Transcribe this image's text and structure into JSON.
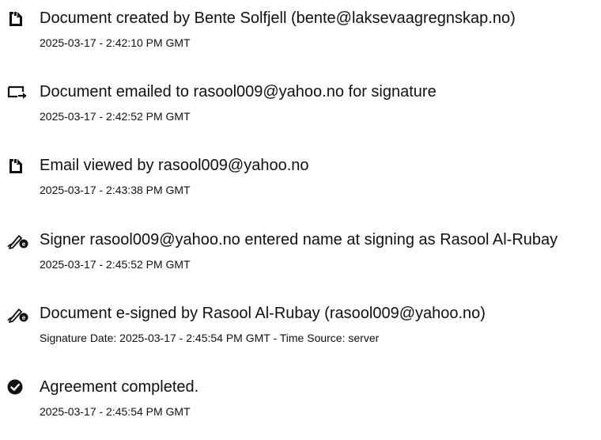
{
  "events": [
    {
      "icon": "document-icon",
      "title": "Document created by Bente Solfjell (bente@laksevaagregnskap.no)",
      "time": "2025-03-17 - 2:42:10 PM GMT"
    },
    {
      "icon": "email-sent-icon",
      "title": "Document emailed to rasool009@yahoo.no for signature",
      "time": "2025-03-17 - 2:42:52 PM GMT"
    },
    {
      "icon": "document-icon",
      "title": "Email viewed by rasool009@yahoo.no",
      "time": "2025-03-17 - 2:43:38 PM GMT"
    },
    {
      "icon": "e-sign-pen-icon",
      "title": "Signer rasool009@yahoo.no entered name at signing as Rasool Al-Rubay",
      "time": "2025-03-17 - 2:45:52 PM GMT"
    },
    {
      "icon": "e-sign-pen-icon",
      "title": "Document e-signed by Rasool Al-Rubay (rasool009@yahoo.no)",
      "time": "Signature Date: 2025-03-17 - 2:45:54 PM GMT - Time Source: server"
    },
    {
      "icon": "check-circle-icon",
      "title": "Agreement completed.",
      "time": "2025-03-17 - 2:45:54 PM GMT"
    }
  ]
}
